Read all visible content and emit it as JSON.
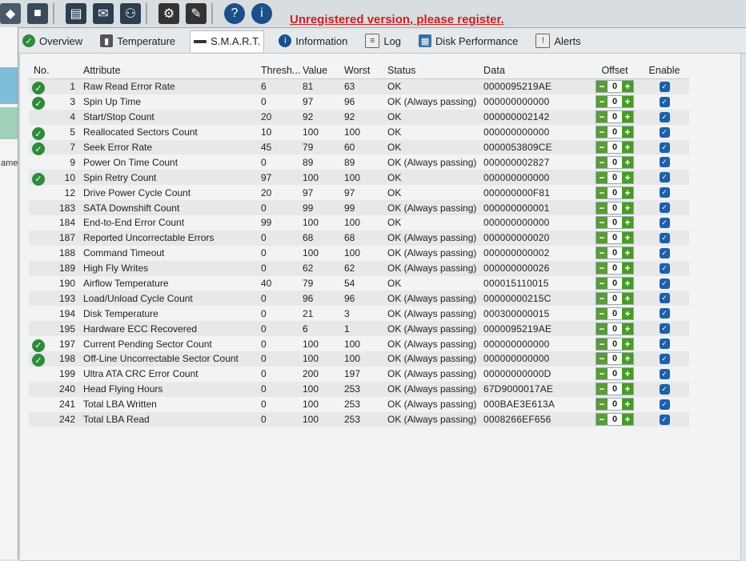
{
  "header": {
    "register_notice": "Unregistered version, please register."
  },
  "left_panel": {
    "partial_text": "ame"
  },
  "tabs": [
    {
      "label": "Overview",
      "icon": "check-icon"
    },
    {
      "label": "Temperature",
      "icon": "thermometer-icon"
    },
    {
      "label": "S.M.A.R.T.",
      "icon": "minus-icon"
    },
    {
      "label": "Information",
      "icon": "info-icon"
    },
    {
      "label": "Log",
      "icon": "document-icon"
    },
    {
      "label": "Disk Performance",
      "icon": "chart-icon"
    },
    {
      "label": "Alerts",
      "icon": "alert-icon"
    }
  ],
  "columns": {
    "no": "No.",
    "attribute": "Attribute",
    "threshold": "Thresh...",
    "value": "Value",
    "worst": "Worst",
    "status": "Status",
    "data": "Data",
    "offset": "Offset",
    "enable": "Enable"
  },
  "rows": [
    {
      "no": "1",
      "attr": "Raw Read Error Rate",
      "thr": "6",
      "val": "81",
      "worst": "63",
      "status": "OK",
      "data": "0000095219AE",
      "check": true
    },
    {
      "no": "3",
      "attr": "Spin Up Time",
      "thr": "0",
      "val": "97",
      "worst": "96",
      "status": "OK (Always passing)",
      "data": "000000000000",
      "check": true
    },
    {
      "no": "4",
      "attr": "Start/Stop Count",
      "thr": "20",
      "val": "92",
      "worst": "92",
      "status": "OK",
      "data": "000000002142",
      "check": false
    },
    {
      "no": "5",
      "attr": "Reallocated Sectors Count",
      "thr": "10",
      "val": "100",
      "worst": "100",
      "status": "OK",
      "data": "000000000000",
      "check": true
    },
    {
      "no": "7",
      "attr": "Seek Error Rate",
      "thr": "45",
      "val": "79",
      "worst": "60",
      "status": "OK",
      "data": "0000053809CE",
      "check": true
    },
    {
      "no": "9",
      "attr": "Power On Time Count",
      "thr": "0",
      "val": "89",
      "worst": "89",
      "status": "OK (Always passing)",
      "data": "000000002827",
      "check": false
    },
    {
      "no": "10",
      "attr": "Spin Retry Count",
      "thr": "97",
      "val": "100",
      "worst": "100",
      "status": "OK",
      "data": "000000000000",
      "check": true
    },
    {
      "no": "12",
      "attr": "Drive Power Cycle Count",
      "thr": "20",
      "val": "97",
      "worst": "97",
      "status": "OK",
      "data": "000000000F81",
      "check": false
    },
    {
      "no": "183",
      "attr": "SATA Downshift Count",
      "thr": "0",
      "val": "99",
      "worst": "99",
      "status": "OK (Always passing)",
      "data": "000000000001",
      "check": false
    },
    {
      "no": "184",
      "attr": "End-to-End Error Count",
      "thr": "99",
      "val": "100",
      "worst": "100",
      "status": "OK",
      "data": "000000000000",
      "check": false
    },
    {
      "no": "187",
      "attr": "Reported Uncorrectable Errors",
      "thr": "0",
      "val": "68",
      "worst": "68",
      "status": "OK (Always passing)",
      "data": "000000000020",
      "check": false
    },
    {
      "no": "188",
      "attr": "Command Timeout",
      "thr": "0",
      "val": "100",
      "worst": "100",
      "status": "OK (Always passing)",
      "data": "000000000002",
      "check": false
    },
    {
      "no": "189",
      "attr": "High Fly Writes",
      "thr": "0",
      "val": "62",
      "worst": "62",
      "status": "OK (Always passing)",
      "data": "000000000026",
      "check": false
    },
    {
      "no": "190",
      "attr": "Airflow Temperature",
      "thr": "40",
      "val": "79",
      "worst": "54",
      "status": "OK",
      "data": "000015110015",
      "check": false
    },
    {
      "no": "193",
      "attr": "Load/Unload Cycle Count",
      "thr": "0",
      "val": "96",
      "worst": "96",
      "status": "OK (Always passing)",
      "data": "00000000215C",
      "check": false
    },
    {
      "no": "194",
      "attr": "Disk Temperature",
      "thr": "0",
      "val": "21",
      "worst": "3",
      "status": "OK (Always passing)",
      "data": "000300000015",
      "check": false
    },
    {
      "no": "195",
      "attr": "Hardware ECC Recovered",
      "thr": "0",
      "val": "6",
      "worst": "1",
      "status": "OK (Always passing)",
      "data": "0000095219AE",
      "check": false
    },
    {
      "no": "197",
      "attr": "Current Pending Sector Count",
      "thr": "0",
      "val": "100",
      "worst": "100",
      "status": "OK (Always passing)",
      "data": "000000000000",
      "check": true
    },
    {
      "no": "198",
      "attr": "Off-Line Uncorrectable Sector Count",
      "thr": "0",
      "val": "100",
      "worst": "100",
      "status": "OK (Always passing)",
      "data": "000000000000",
      "check": true
    },
    {
      "no": "199",
      "attr": "Ultra ATA CRC Error Count",
      "thr": "0",
      "val": "200",
      "worst": "197",
      "status": "OK (Always passing)",
      "data": "00000000000D",
      "check": false
    },
    {
      "no": "240",
      "attr": "Head Flying Hours",
      "thr": "0",
      "val": "100",
      "worst": "253",
      "status": "OK (Always passing)",
      "data": "67D9000017AE",
      "check": false
    },
    {
      "no": "241",
      "attr": "Total LBA Written",
      "thr": "0",
      "val": "100",
      "worst": "253",
      "status": "OK (Always passing)",
      "data": "000BAE3E613A",
      "check": false
    },
    {
      "no": "242",
      "attr": "Total LBA Read",
      "thr": "0",
      "val": "100",
      "worst": "253",
      "status": "OK (Always passing)",
      "data": "0008266EF656",
      "check": false
    }
  ],
  "offset_value": "0",
  "colors": {
    "register_notice": "#d02020",
    "check_green": "#2f8a3a",
    "enable_blue": "#1d5fa8"
  }
}
